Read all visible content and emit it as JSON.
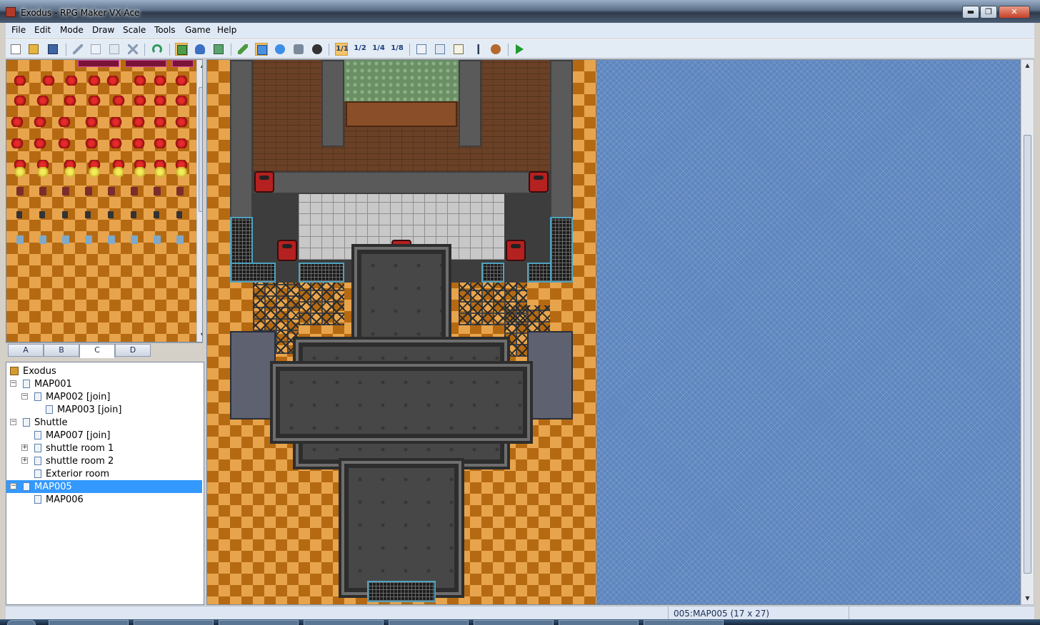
{
  "window": {
    "title": "Exodus - RPG Maker VX Ace",
    "minimize_glyph": "▬",
    "maximize_glyph": "❐",
    "close_glyph": "✕"
  },
  "menu": [
    "File",
    "Edit",
    "Mode",
    "Draw",
    "Scale",
    "Tools",
    "Game",
    "Help"
  ],
  "toolbar": {
    "icons": [
      "new-project-icon",
      "open-project-icon",
      "save-project-icon",
      "cut-icon",
      "copy-icon",
      "paste-icon",
      "delete-icon",
      "undo-icon",
      "map-mode-icon",
      "event-mode-icon",
      "region-mode-icon",
      "pencil-icon",
      "rectangle-icon",
      "ellipse-icon",
      "flood-fill-icon",
      "shadow-pen-icon",
      "scale-1-1-icon",
      "scale-1-2-icon",
      "scale-1-4-icon",
      "scale-1-8-icon",
      "database-icon",
      "resource-manager-icon",
      "script-editor-icon",
      "sound-test-icon",
      "character-generator-icon",
      "playtest-icon"
    ],
    "scale_labels": [
      "1/1",
      "1/2",
      "1/4",
      "1/8"
    ],
    "active": [
      "map-mode-icon",
      "rectangle-icon",
      "scale-1-1-icon"
    ]
  },
  "tileset_tabs": [
    "A",
    "B",
    "C",
    "D"
  ],
  "selected_tab": "C",
  "map_tree": [
    {
      "label": "Exodus",
      "depth": 0,
      "type": "project",
      "expander": ""
    },
    {
      "label": "MAP001",
      "depth": 0,
      "type": "map",
      "expander": "−"
    },
    {
      "label": "MAP002 [join]",
      "depth": 1,
      "type": "map",
      "expander": "−"
    },
    {
      "label": "MAP003 [join]",
      "depth": 2,
      "type": "map",
      "expander": ""
    },
    {
      "label": "Shuttle",
      "depth": 0,
      "type": "map",
      "expander": "−"
    },
    {
      "label": "MAP007 [join]",
      "depth": 1,
      "type": "map",
      "expander": ""
    },
    {
      "label": "shuttle room 1",
      "depth": 1,
      "type": "map",
      "expander": "+"
    },
    {
      "label": "shuttle room 2",
      "depth": 1,
      "type": "map",
      "expander": "+"
    },
    {
      "label": "Exterior room",
      "depth": 1,
      "type": "map",
      "expander": ""
    },
    {
      "label": "MAP005",
      "depth": 0,
      "type": "map",
      "expander": "−",
      "selected": true
    },
    {
      "label": "MAP006",
      "depth": 1,
      "type": "map",
      "expander": ""
    }
  ],
  "status": {
    "map_info": "005:MAP005 (17 x 27)"
  },
  "colors": {
    "selection": "#3399ff",
    "map_background": "#5e86bf",
    "transparent_checker_a": "#e7a44c",
    "transparent_checker_b": "#b56a12"
  }
}
